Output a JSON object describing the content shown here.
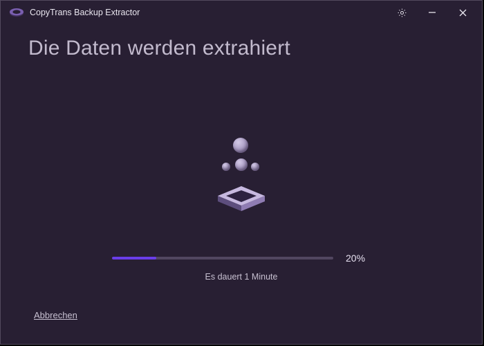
{
  "app": {
    "title": "CopyTrans Backup Extractor"
  },
  "main": {
    "heading": "Die Daten werden extrahiert"
  },
  "progress": {
    "percent_value": 20,
    "percent_label": "20%",
    "status": "Es dauert 1 Minute"
  },
  "actions": {
    "cancel_label": "Abbrechen"
  },
  "icons": {
    "app_logo": "copytrans-logo",
    "settings": "gear-icon",
    "minimize": "minimize-icon",
    "close": "close-icon"
  },
  "colors": {
    "background": "#281f33",
    "progress_track": "#514660",
    "progress_fill": "#6a3de8"
  }
}
